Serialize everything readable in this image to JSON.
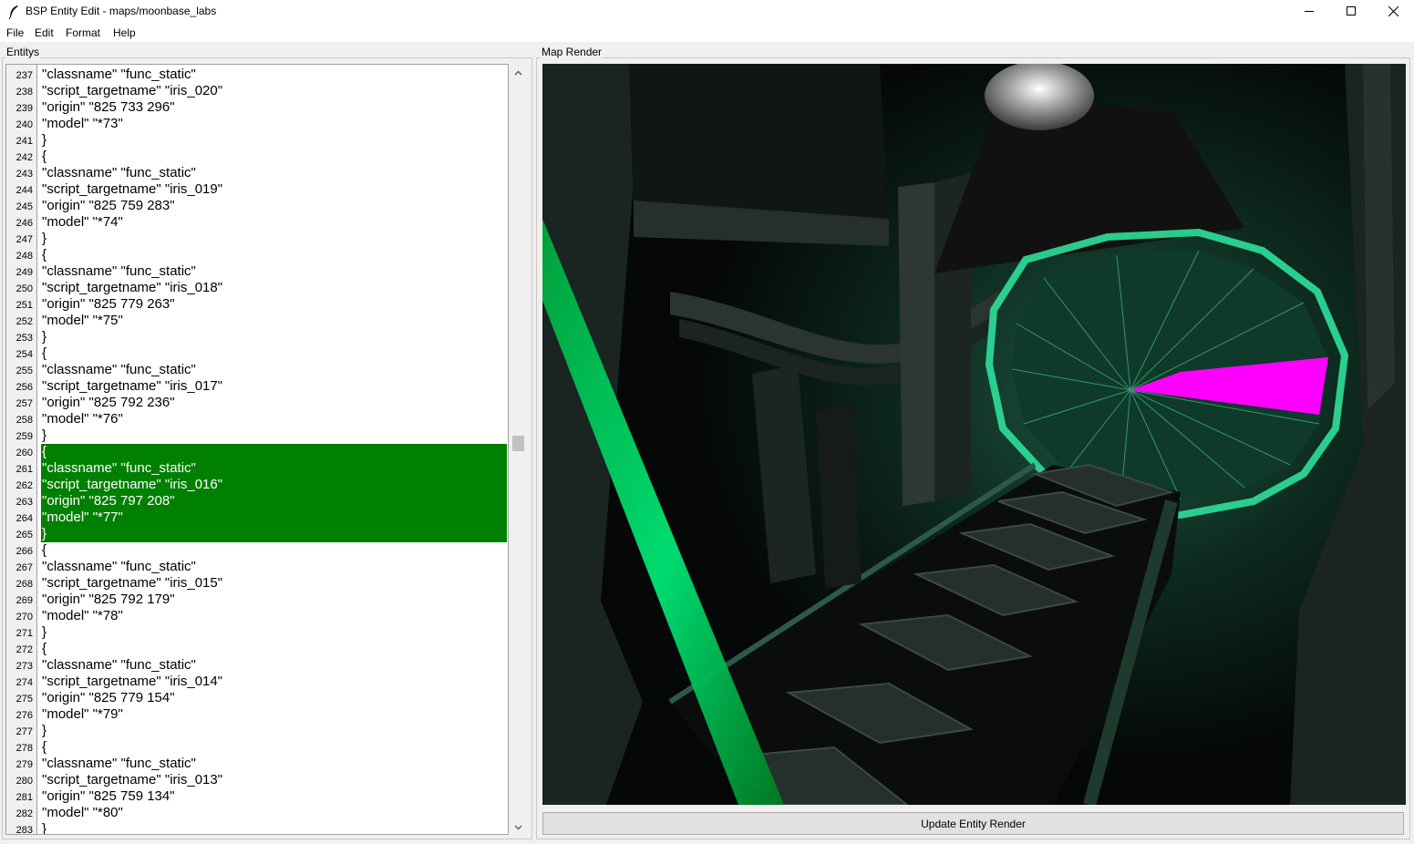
{
  "window": {
    "title": "BSP Entity Edit - maps/moonbase_labs",
    "icons": [
      "feather-icon",
      "minimize-icon",
      "maximize-icon",
      "close-icon"
    ]
  },
  "menu": [
    "File",
    "Edit",
    "Format",
    "Help"
  ],
  "entity_panel": {
    "label": "Entitys",
    "highlight_color": "#008000",
    "lines": [
      {
        "n": "237",
        "text": "\"classname\" \"func_static\""
      },
      {
        "n": "238",
        "text": "\"script_targetname\" \"iris_020\""
      },
      {
        "n": "239",
        "text": "\"origin\" \"825 733 296\""
      },
      {
        "n": "240",
        "text": "\"model\" \"*73\""
      },
      {
        "n": "241",
        "text": "}"
      },
      {
        "n": "242",
        "text": "{"
      },
      {
        "n": "243",
        "text": "\"classname\" \"func_static\""
      },
      {
        "n": "244",
        "text": "\"script_targetname\" \"iris_019\""
      },
      {
        "n": "245",
        "text": "\"origin\" \"825 759 283\""
      },
      {
        "n": "246",
        "text": "\"model\" \"*74\""
      },
      {
        "n": "247",
        "text": "}"
      },
      {
        "n": "248",
        "text": "{"
      },
      {
        "n": "249",
        "text": "\"classname\" \"func_static\""
      },
      {
        "n": "250",
        "text": "\"script_targetname\" \"iris_018\""
      },
      {
        "n": "251",
        "text": "\"origin\" \"825 779 263\""
      },
      {
        "n": "252",
        "text": "\"model\" \"*75\""
      },
      {
        "n": "253",
        "text": "}"
      },
      {
        "n": "254",
        "text": "{"
      },
      {
        "n": "255",
        "text": "\"classname\" \"func_static\""
      },
      {
        "n": "256",
        "text": "\"script_targetname\" \"iris_017\""
      },
      {
        "n": "257",
        "text": "\"origin\" \"825 792 236\""
      },
      {
        "n": "258",
        "text": "\"model\" \"*76\""
      },
      {
        "n": "259",
        "text": "}"
      },
      {
        "n": "260",
        "text": "{"
      },
      {
        "n": "261",
        "text": "\"classname\" \"func_static\""
      },
      {
        "n": "262",
        "text": "\"script_targetname\" \"iris_016\""
      },
      {
        "n": "263",
        "text": "\"origin\" \"825 797 208\""
      },
      {
        "n": "264",
        "text": "\"model\" \"*77\""
      },
      {
        "n": "265",
        "text": "}"
      },
      {
        "n": "266",
        "text": "{"
      },
      {
        "n": "267",
        "text": "\"classname\" \"func_static\""
      },
      {
        "n": "268",
        "text": "\"script_targetname\" \"iris_015\""
      },
      {
        "n": "269",
        "text": "\"origin\" \"825 792 179\""
      },
      {
        "n": "270",
        "text": "\"model\" \"*78\""
      },
      {
        "n": "271",
        "text": "}"
      },
      {
        "n": "272",
        "text": "{"
      },
      {
        "n": "273",
        "text": "\"classname\" \"func_static\""
      },
      {
        "n": "274",
        "text": "\"script_targetname\" \"iris_014\""
      },
      {
        "n": "275",
        "text": "\"origin\" \"825 779 154\""
      },
      {
        "n": "276",
        "text": "\"model\" \"*79\""
      },
      {
        "n": "277",
        "text": "}"
      },
      {
        "n": "278",
        "text": "{"
      },
      {
        "n": "279",
        "text": "\"classname\" \"func_static\""
      },
      {
        "n": "280",
        "text": "\"script_targetname\" \"iris_013\""
      },
      {
        "n": "281",
        "text": "\"origin\" \"825 759 134\""
      },
      {
        "n": "282",
        "text": "\"model\" \"*80\""
      },
      {
        "n": "283",
        "text": "}"
      }
    ],
    "selected_from": "260",
    "selected_to": "265"
  },
  "render_panel": {
    "label": "Map Render",
    "update_button": "Update Entity Render",
    "colors": {
      "tunnel": "#2ee09a",
      "selected_entity": "#ff00ff",
      "green_beam": "#00c853"
    }
  }
}
